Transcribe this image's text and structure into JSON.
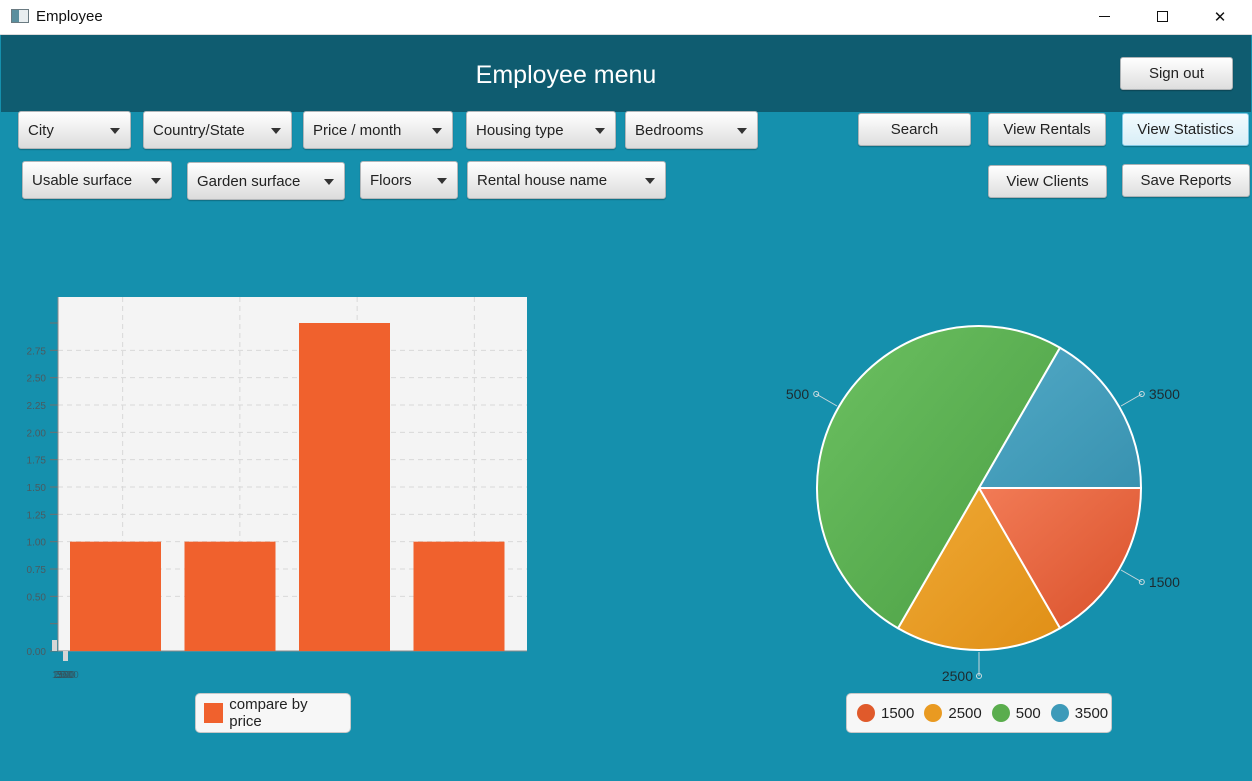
{
  "window": {
    "title": "Employee"
  },
  "header": {
    "title": "Employee menu",
    "signout_label": "Sign out"
  },
  "filters": {
    "city": "City",
    "country_state": "Country/State",
    "price_month": "Price / month",
    "housing_type": "Housing type",
    "bedrooms": "Bedrooms",
    "usable_surface": "Usable surface",
    "garden_surface": "Garden surface",
    "floors": "Floors",
    "rental_house_name": "Rental house name"
  },
  "actions": {
    "search": "Search",
    "view_rentals": "View Rentals",
    "view_statistics": "View Statistics",
    "view_clients": "View Clients",
    "save_reports": "Save Reports"
  },
  "colors": {
    "background": "#1590ad",
    "header": "#0f5c70",
    "bar": "#f0612d",
    "pie_1500": "#e05a2b",
    "pie_2500": "#e99a21",
    "pie_500": "#5aad4d",
    "pie_3500": "#3d9ab9"
  },
  "chart_data": [
    {
      "type": "bar",
      "categories": [
        "1500",
        "2500",
        "500",
        "3500"
      ],
      "x_tick_labels_overlapping": "1500",
      "series": [
        {
          "name": "compare by price",
          "values": [
            1,
            1,
            3,
            1
          ]
        }
      ],
      "ylim": [
        0,
        3
      ],
      "yticks": [
        "0.00",
        "0.50",
        "0.75",
        "1.00",
        "1.25",
        "1.50",
        "1.75",
        "2.00",
        "2.25",
        "2.50",
        "2.75"
      ],
      "grid": true,
      "legend": "bottom"
    },
    {
      "type": "pie",
      "slices": [
        {
          "label": "1500",
          "value": 1
        },
        {
          "label": "2500",
          "value": 1
        },
        {
          "label": "500",
          "value": 3
        },
        {
          "label": "3500",
          "value": 1
        }
      ],
      "legend": "bottom"
    }
  ]
}
